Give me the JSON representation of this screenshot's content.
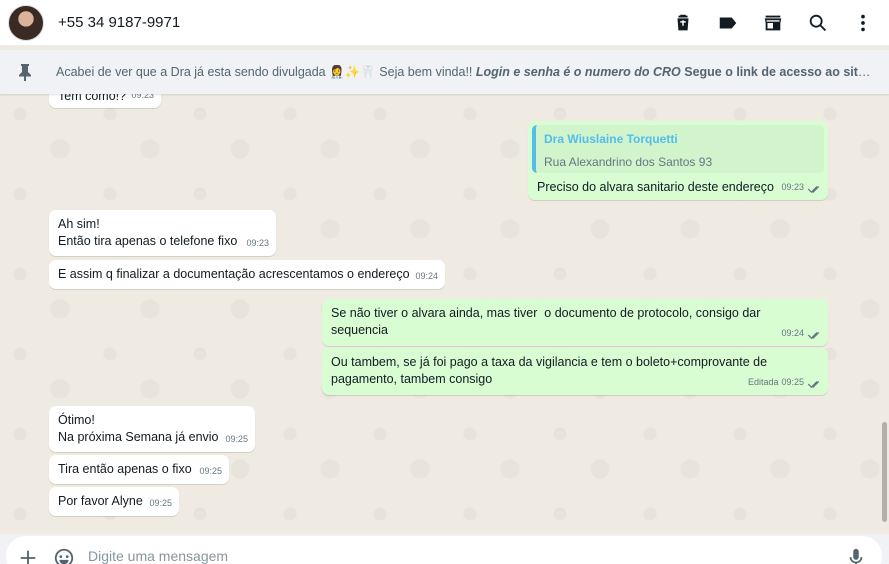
{
  "header": {
    "contact_name": "+55 34 9187-9971",
    "icons": [
      "delete-icon",
      "label-icon",
      "store-icon",
      "search-icon",
      "menu-icon"
    ]
  },
  "pinned": {
    "text_start": "Acabei de ver que a Dra já esta sendo divulgada ",
    "emojis": "👩‍⚕️✨🦷",
    "text_mid": " Seja bem vinda!! ",
    "text_italic": "Login e senha é o numero do CRO",
    "text_end": " Segue o link de acesso ao site..."
  },
  "messages": [
    {
      "id": "m0",
      "dir": "in",
      "text": "Tem como!?",
      "time": "09:23"
    },
    {
      "id": "m1",
      "dir": "out",
      "quote_author": "Dra Wiuslaine Torquetti",
      "quote_text": "Rua Alexandrino dos Santos 93",
      "text": "Preciso do alvara sanitario deste endereço",
      "time": "09:23"
    },
    {
      "id": "m2",
      "dir": "in",
      "text": "Ah sim!\nEntão tira apenas o telefone fixo",
      "time": "09:23"
    },
    {
      "id": "m3",
      "dir": "in",
      "text": "E assim q finalizar a documentação acrescentamos o endereço",
      "time": "09:24"
    },
    {
      "id": "m4",
      "dir": "out",
      "text": "Se não tiver o alvara ainda, mas tiver  o documento de protocolo, consigo dar\nsequencia",
      "time": "09:24"
    },
    {
      "id": "m5",
      "dir": "out",
      "text": "Ou tambem, se já foi pago a taxa da vigilancia e tem o boleto+comprovante de\npagamento, tambem consigo",
      "time": "09:25",
      "edited_label": "Editada"
    },
    {
      "id": "m6",
      "dir": "in",
      "text": "Ótimo!\nNa próxima Semana já envio",
      "time": "09:25"
    },
    {
      "id": "m7",
      "dir": "in",
      "text": "Tira então apenas o fixo",
      "time": "09:25"
    },
    {
      "id": "m8",
      "dir": "in",
      "text": "Por favor Alyne",
      "time": "09:25"
    }
  ],
  "composer": {
    "placeholder": "Digite uma mensagem"
  },
  "colors": {
    "incoming": "#ffffff",
    "outgoing": "#d9fdd3",
    "quote_accent": "#53bdeb",
    "chat_bg": "#efeae2"
  }
}
